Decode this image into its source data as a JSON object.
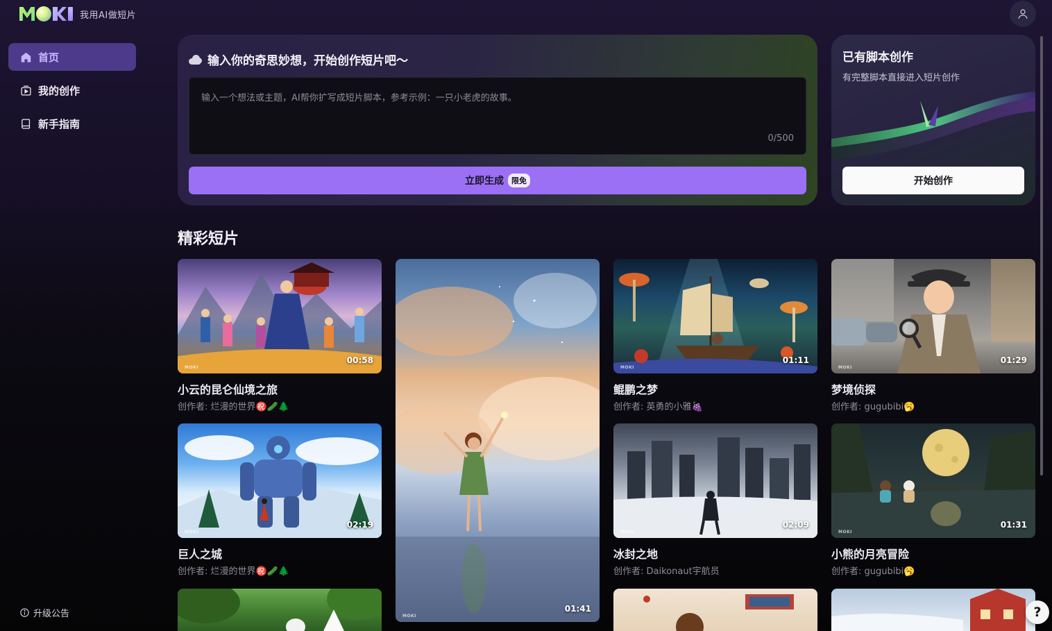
{
  "header": {
    "tagline": "我用AI做短片"
  },
  "sidebar": {
    "items": [
      {
        "label": "首页",
        "icon": "home-icon",
        "active": true
      },
      {
        "label": "我的创作",
        "icon": "creation-icon",
        "active": false
      },
      {
        "label": "新手指南",
        "icon": "book-icon",
        "active": false
      }
    ],
    "upgrade_label": "升级公告"
  },
  "prompt": {
    "title": "输入你的奇思妙想，开始创作短片吧～",
    "placeholder": "输入一个想法或主题，AI帮你扩写成短片脚本，参考示例：一只小老虎的故事。",
    "count": "0/500",
    "generate_label": "立即生成",
    "free_badge": "限免"
  },
  "script_card": {
    "title": "已有脚本创作",
    "subtitle": "有完整脚本直接进入短片创作",
    "start_label": "开始创作"
  },
  "section_title": "精彩短片",
  "videos": [
    {
      "title": "小云的昆仑仙境之旅",
      "author": "创作者: 烂漫的世界㊗️🥒🌲",
      "duration": "00:58"
    },
    {
      "title": "巨人之城",
      "author": "创作者: 烂漫的世界㊗️🥒🌲",
      "duration": "02:19"
    },
    {
      "title": "",
      "author": "",
      "duration": "01:41"
    },
    {
      "title": "鲲鹏之梦",
      "author": "创作者: 英勇的小雅🍇",
      "duration": "01:11"
    },
    {
      "title": "冰封之地",
      "author": "创作者: Daikonaut宇航员",
      "duration": "02:09"
    },
    {
      "title": "梦境侦探",
      "author": "创作者: gugubibi🥱",
      "duration": "01:29"
    },
    {
      "title": "小熊的月亮冒险",
      "author": "创作者: gugubibi🥱",
      "duration": "01:31"
    }
  ],
  "help_label": "?",
  "colors": {
    "accent": "#9b70f5",
    "nav_active_bg": "#4d3a8a",
    "nav_active_text": "#c6b6ff"
  }
}
